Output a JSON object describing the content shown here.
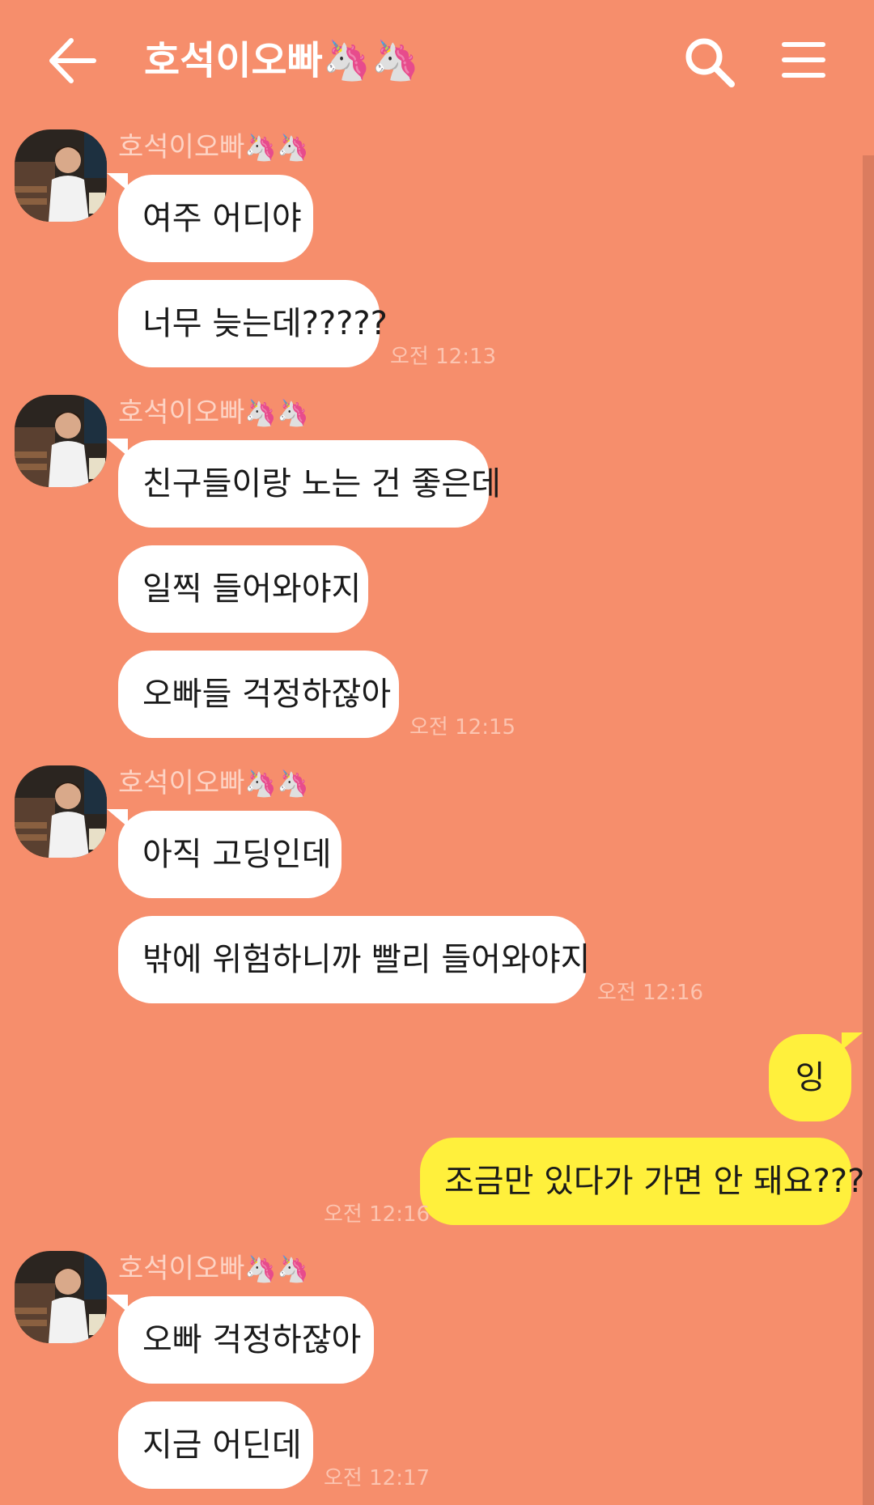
{
  "header": {
    "title": "호석이오빠🦄🦄",
    "back_icon": "arrow-left-icon",
    "search_icon": "search-icon",
    "menu_icon": "hamburger-menu-icon"
  },
  "colors": {
    "background": "#f68e6c",
    "incoming_bubble": "#ffffff",
    "outgoing_bubble": "#fff03c",
    "sender_name": "#fdd3c4",
    "timestamp": "#fcc4b0"
  },
  "sender": {
    "name": "호석이오빠",
    "name_emoji": "🦄🦄"
  },
  "messages": [
    {
      "from": "other",
      "text": "여주 어디야"
    },
    {
      "from": "other",
      "text": "너무 늦는데?????",
      "time": "오전 12:13"
    },
    {
      "from": "other",
      "text": "친구들이랑 노는 건 좋은데"
    },
    {
      "from": "other",
      "text": "일찍 들어와야지"
    },
    {
      "from": "other",
      "text": "오빠들 걱정하잖아",
      "time": "오전 12:15"
    },
    {
      "from": "other",
      "text": "아직 고딩인데"
    },
    {
      "from": "other",
      "text": "밖에 위험하니까 빨리 들어와야지",
      "time": "오전 12:16"
    },
    {
      "from": "me",
      "text": "잉"
    },
    {
      "from": "me",
      "text": "조금만 있다가 가면 안 돼요???",
      "time": "오전 12:16"
    },
    {
      "from": "other",
      "text": "오빠 걱정하잖아"
    },
    {
      "from": "other",
      "text": "지금 어딘데",
      "time": "오전 12:17"
    }
  ]
}
